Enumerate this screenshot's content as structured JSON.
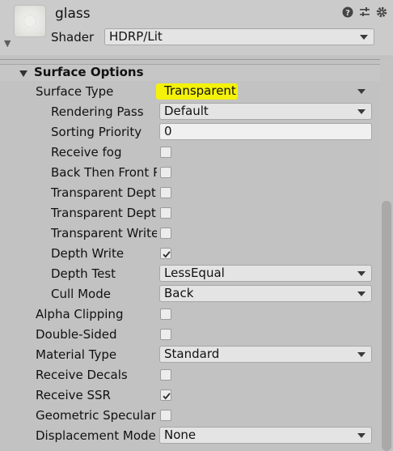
{
  "header": {
    "title": "glass",
    "shader_label": "Shader",
    "shader_value": "HDRP/Lit",
    "icons": [
      "help-icon",
      "preset-sliders-icon",
      "gear-icon"
    ]
  },
  "section": {
    "title": "Surface Options"
  },
  "surface_type": {
    "label": "Surface Type",
    "value": "Transparent",
    "highlight_color": "#f4f20a"
  },
  "rendering_pass": {
    "label": "Rendering Pass",
    "value": "Default"
  },
  "sorting_priority": {
    "label": "Sorting Priority",
    "value": "0"
  },
  "receive_fog": {
    "label": "Receive fog",
    "checked": false
  },
  "back_then_front": {
    "label": "Back Then Front Rendering",
    "checked": false
  },
  "transparent_depth_prepass": {
    "label": "Transparent Depth Prepass",
    "checked": false
  },
  "transparent_depth_postpass": {
    "label": "Transparent Depth Postpass",
    "checked": false
  },
  "transparent_writes_motion": {
    "label": "Transparent Writes Motion Vectors",
    "checked": false
  },
  "depth_write": {
    "label": "Depth Write",
    "checked": true
  },
  "depth_test": {
    "label": "Depth Test",
    "value": "LessEqual"
  },
  "cull_mode": {
    "label": "Cull Mode",
    "value": "Back"
  },
  "alpha_clipping": {
    "label": "Alpha Clipping",
    "checked": false
  },
  "double_sided": {
    "label": "Double-Sided",
    "checked": false
  },
  "material_type": {
    "label": "Material Type",
    "value": "Standard"
  },
  "receive_decals": {
    "label": "Receive Decals",
    "checked": false
  },
  "receive_ssr": {
    "label": "Receive SSR",
    "checked": true
  },
  "geometric_specular_aa": {
    "label": "Geometric Specular AA",
    "checked": false
  },
  "displacement_mode": {
    "label": "Displacement Mode",
    "value": "None"
  }
}
